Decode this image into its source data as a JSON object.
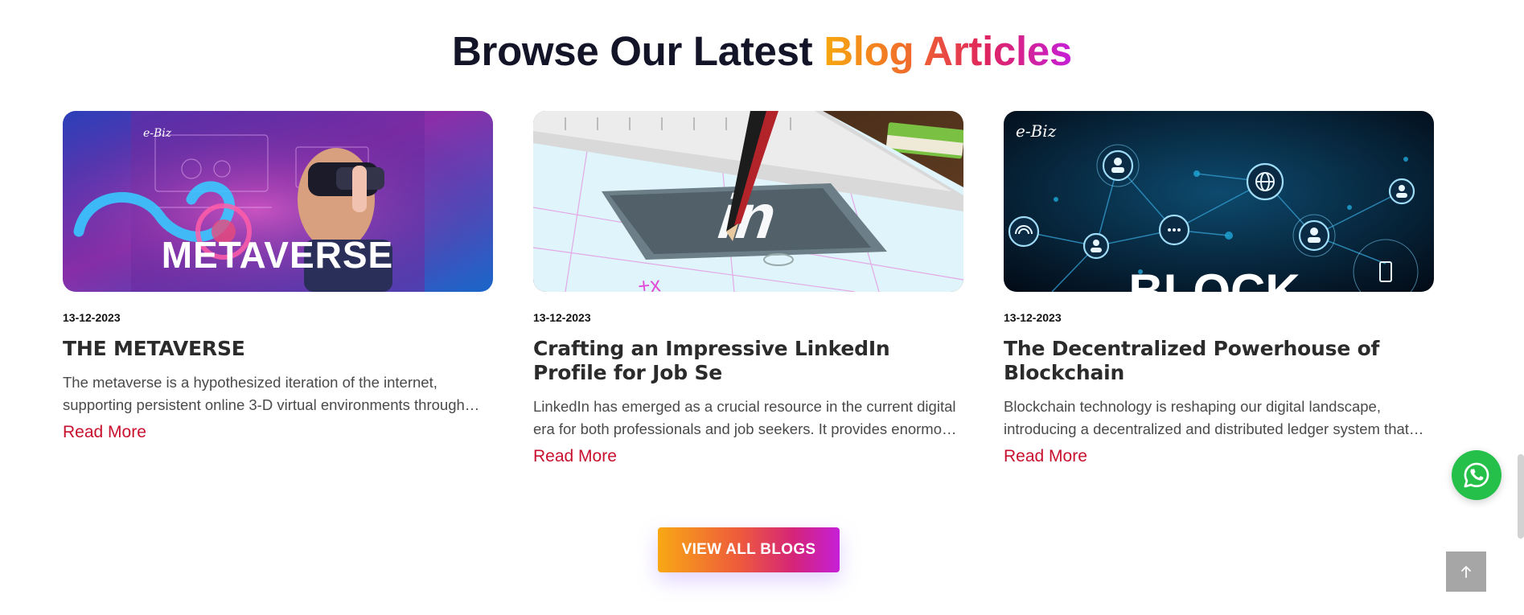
{
  "section": {
    "title_prefix": "Browse Our Latest ",
    "title_highlight": "Blog Articles"
  },
  "posts": [
    {
      "image_text": "METAVERSE",
      "logo_text": "e-Biz",
      "date": "13-12-2023",
      "title": "THE METAVERSE",
      "excerpt": "The metaverse is a hypothesized iteration of the internet, supporting persistent online 3-D virtual environments through conventional personal computing.",
      "read_more": "Read More"
    },
    {
      "image_text": "in",
      "logo_text": "",
      "date": "13-12-2023",
      "title": "Crafting an Impressive LinkedIn Profile for Job Se",
      "excerpt": "LinkedIn has emerged as a crucial resource in the current digital era for both professionals and job seekers. It provides enormous opportunities.",
      "read_more": "Read More"
    },
    {
      "image_text": "BLOCK",
      "logo_text": "e-Biz",
      "date": "13-12-2023",
      "title": "The Decentralized Powerhouse of Blockchain",
      "excerpt": "Blockchain technology is reshaping our digital landscape, introducing a decentralized and distributed ledger system that records transactions.",
      "read_more": "Read More"
    }
  ],
  "view_all_label": "VIEW ALL BLOGS",
  "icons": {
    "whatsapp": "whatsapp-icon",
    "back_to_top": "arrow-up-icon"
  },
  "colors": {
    "read_more": "#c8102e",
    "whatsapp": "#25c04a",
    "back_to_top": "#a6a6a6"
  }
}
